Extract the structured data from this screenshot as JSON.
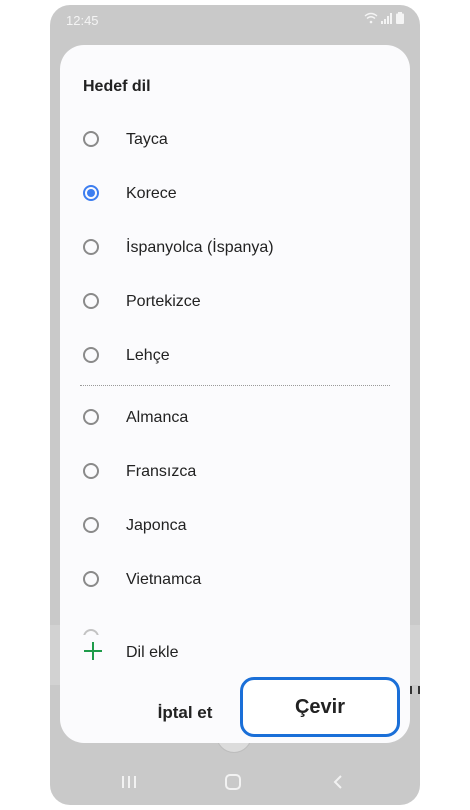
{
  "status_bar": {
    "time": "12:45"
  },
  "sheet": {
    "title": "Hedef dil",
    "options": [
      {
        "label": "Tayca",
        "selected": false
      },
      {
        "label": "Korece",
        "selected": true
      },
      {
        "label": "İspanyolca (İspanya)",
        "selected": false
      },
      {
        "label": "Portekizce",
        "selected": false
      },
      {
        "label": "Lehçe",
        "selected": false
      },
      {
        "label": "Almanca",
        "selected": false
      },
      {
        "label": "Fransızca",
        "selected": false
      },
      {
        "label": "Japonca",
        "selected": false
      },
      {
        "label": "Vietnamca",
        "selected": false
      }
    ],
    "add_language": {
      "label": "Dil ekle",
      "icon": "plus-icon",
      "icon_color": "#1e9b4a"
    },
    "cancel_label": "İptal et",
    "translate_label": "Çevir"
  },
  "colors": {
    "accent": "#3d7ef0",
    "highlight_border": "#1a6fd8"
  }
}
